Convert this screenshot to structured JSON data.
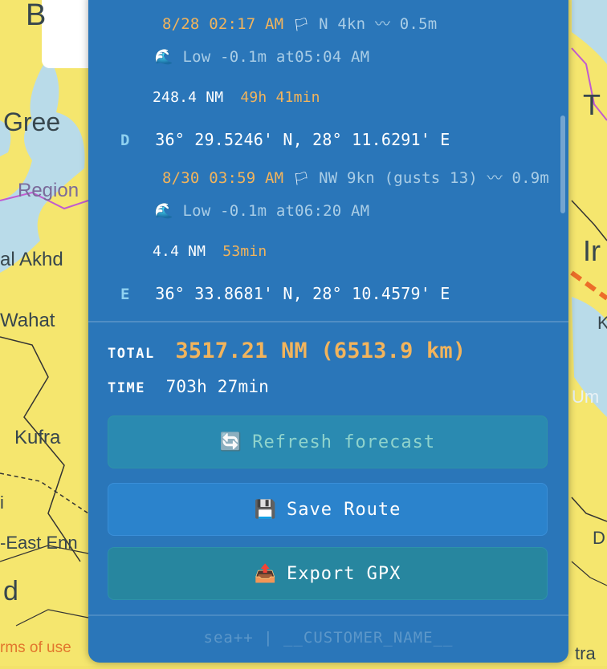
{
  "map": {
    "labels": [
      "B",
      "Gree",
      "Region",
      "al Akhd",
      "Wahat",
      "Kufra",
      "i",
      "-East Enn",
      "d",
      "rms of use",
      "T",
      "Ir",
      "K",
      "Um",
      "D",
      "tra"
    ]
  },
  "panel": {
    "legs": [
      {
        "eta": "8/28 02:17 AM",
        "wind_icon": "wind-flag-icon",
        "wind": "N 4kn",
        "wave_icon": "wave-icon",
        "wave": "0.5m",
        "tide_icon": "tide-icon",
        "tide": "Low -0.1m at05:04 AM",
        "distance": "248.4 NM",
        "duration": "49h 41min"
      },
      {
        "eta": "8/30 03:59 AM",
        "wind_icon": "wind-flag-icon",
        "wind": "NW 9kn (gusts 13)",
        "wave_icon": "wave-icon",
        "wave": "0.9m",
        "tide_icon": "tide-icon",
        "tide": "Low -0.1m at06:20 AM",
        "distance": "4.4 NM",
        "duration": "53min"
      }
    ],
    "waypoints": [
      {
        "letter": "D",
        "coords": "36° 29.5246' N, 28° 11.6291' E"
      },
      {
        "letter": "E",
        "coords": "36° 33.8681' N, 28° 10.4579' E"
      }
    ],
    "totals": {
      "total_label": "TOTAL",
      "total_value": "3517.21 NM (6513.9 km)",
      "time_label": "TIME",
      "time_value": "703h 27min"
    },
    "buttons": {
      "refresh": {
        "icon": "refresh-icon",
        "label": "Refresh forecast"
      },
      "save": {
        "icon": "floppy-disk-icon",
        "label": "Save Route"
      },
      "export": {
        "icon": "outbox-tray-icon",
        "label": "Export GPX"
      }
    },
    "footer": "sea++ | __CUSTOMER_NAME__"
  }
}
